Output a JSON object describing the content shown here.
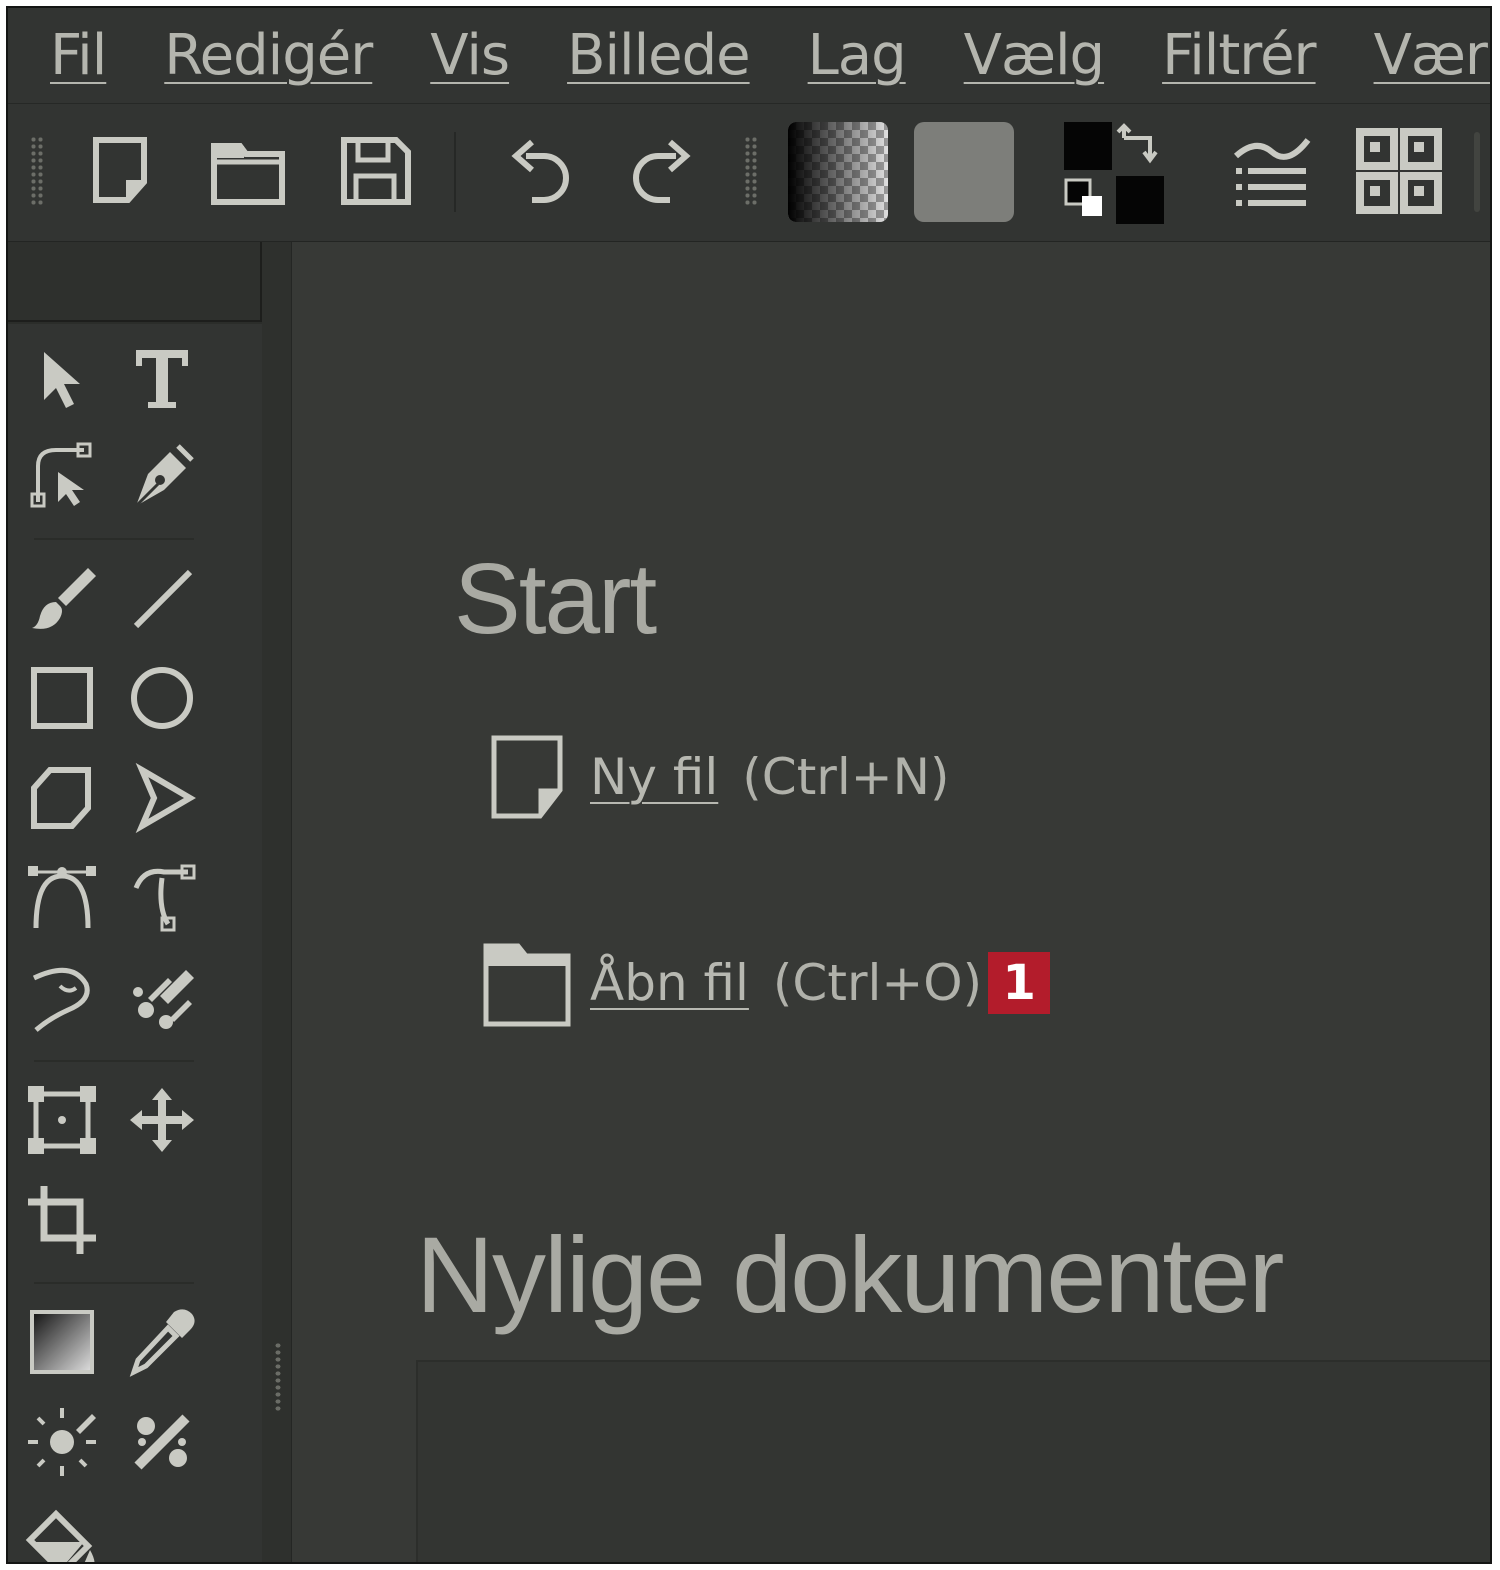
{
  "menu": [
    "Fil",
    "Redigér",
    "Vis",
    "Billede",
    "Lag",
    "Vælg",
    "Filtrér",
    "Værktø"
  ],
  "toolbar": {
    "buttons": [
      "new-file-icon",
      "open-file-icon",
      "save-icon",
      "undo-icon",
      "redo-icon",
      "gradient-preset-icon",
      "pattern-preset-icon",
      "fg-bg-color-icon",
      "brush-settings-icon",
      "workspace-icon"
    ]
  },
  "tools": [
    "select-icon",
    "text-icon",
    "edit-shapes-icon",
    "calligraphy-pen-icon",
    "freehand-brush-icon",
    "line-icon",
    "rectangle-icon",
    "ellipse-icon",
    "polygon-icon",
    "polyline-icon",
    "bezier-icon",
    "freehand-path-icon",
    "dynamic-brush-icon",
    "multibrush-icon",
    "transform-icon",
    "move-icon",
    "crop-icon",
    "gradient-icon",
    "color-picker-icon",
    "smart-patch-icon",
    "assistant-icon",
    "fill-icon"
  ],
  "welcome": {
    "start_title": "Start",
    "new_file_label": "Ny fil",
    "new_file_shortcut": "(Ctrl+N)",
    "open_file_label": "Åbn fil",
    "open_file_shortcut": "(Ctrl+O)",
    "badge": "1",
    "recent_title": "Nylige dokumenter"
  },
  "colors": {
    "background": "#373936",
    "panel": "#323432",
    "text": "#b9bab3",
    "badge": "#b31c2b"
  }
}
